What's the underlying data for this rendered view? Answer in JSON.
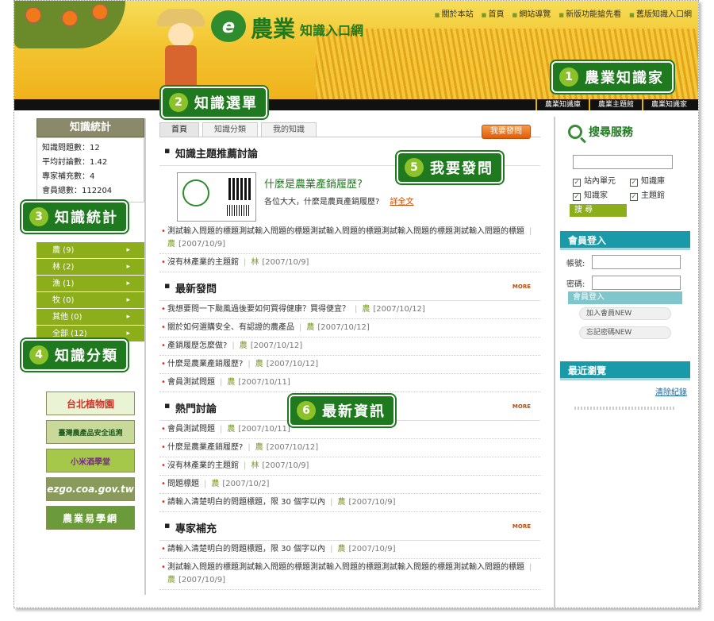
{
  "topnav": [
    "關於本站",
    "首頁",
    "網站導覽",
    "新版功能搶先看",
    "舊版知識入口網"
  ],
  "logo": {
    "mark": "e",
    "big": "農業",
    "small": "知識入口網"
  },
  "subnav": [
    "農業知識庫",
    "農業主題館",
    "農業知識家"
  ],
  "stats": {
    "title": "知識統計",
    "lines": [
      "知識問題數：12",
      "平均討論數：1.42",
      "專家補充數：4",
      "會員總數：112204"
    ]
  },
  "categories": [
    "農 (9)",
    "林 (2)",
    "漁 (1)",
    "牧 (0)",
    "其他 (0)",
    "全部 (12)"
  ],
  "ads": [
    "台北植物園",
    "臺灣農產品安全追溯",
    "小米酒學堂",
    "ezgo.coa.gov.tw",
    "農業易學網"
  ],
  "tabs": [
    "首頁",
    "知識分類",
    "我的知識"
  ],
  "ask_button": "我要發問",
  "featured": {
    "section": "知識主題推薦討論",
    "title": "什麼是農業產銷履歷?",
    "desc": "各位大大，什麼是農頁產銷履歷?",
    "link": "詳全文"
  },
  "featured_rows": [
    {
      "text": "測試輸入問題的標題測試輸入問題的標題測試輸入問題的標題測試輸入問題的標題測試輸入問題的標題",
      "cat": "農",
      "date": "[2007/10/9]"
    },
    {
      "text": "沒有林產業的主題館",
      "cat": "林",
      "date": "[2007/10/9]"
    }
  ],
  "latest": {
    "section": "最新發問",
    "more": "MORE",
    "rows": [
      {
        "text": "我想要問一下颱風過後要如何買得健康？買得便宜？",
        "cat": "農",
        "date": "[2007/10/12]"
      },
      {
        "text": "關於如何選購安全、有認證的農產品",
        "cat": "農",
        "date": "[2007/10/12]"
      },
      {
        "text": "產銷履歷怎麼做?",
        "cat": "農",
        "date": "[2007/10/12]"
      },
      {
        "text": "什麼是農業產銷履歷?",
        "cat": "農",
        "date": "[2007/10/12]"
      },
      {
        "text": "會員測試問題",
        "cat": "農",
        "date": "[2007/10/11]"
      }
    ]
  },
  "hot": {
    "section": "熱門討論",
    "more": "MORE",
    "rows": [
      {
        "text": "會員測試問題",
        "cat": "農",
        "date": "[2007/10/11]"
      },
      {
        "text": "什麼是農業產銷履歷?",
        "cat": "農",
        "date": "[2007/10/12]"
      },
      {
        "text": "沒有林產業的主題館",
        "cat": "林",
        "date": "[2007/10/9]"
      },
      {
        "text": "問題標題",
        "cat": "農",
        "date": "[2007/10/2]"
      },
      {
        "text": "請輸入清楚明白的問題標題，限 30 個字以內",
        "cat": "農",
        "date": "[2007/10/9]"
      }
    ]
  },
  "expert": {
    "section": "專家補充",
    "more": "MORE",
    "rows": [
      {
        "text": "請輸入清楚明白的問題標題，限 30 個字以內",
        "cat": "農",
        "date": "[2007/10/9]"
      },
      {
        "text": "測試輸入問題的標題測試輸入問題的標題測試輸入問題的標題測試輸入問題的標題測試輸入問題的標題",
        "cat": "農",
        "date": "[2007/10/9]"
      }
    ]
  },
  "search": {
    "title": "搜尋服務",
    "options": [
      "站內單元",
      "知識庫",
      "知識家",
      "主題館"
    ],
    "button": "搜 尋"
  },
  "login": {
    "title": "會員登入",
    "account": "帳號:",
    "password": "密碼:",
    "login_btn": "會員登入",
    "join_btn": "加入會員NEW",
    "forgot_btn": "忘記密碼NEW"
  },
  "recent": {
    "title": "最近瀏覽",
    "clear": "清除紀錄"
  },
  "callouts": [
    {
      "num": "1",
      "text": "農業知識家"
    },
    {
      "num": "2",
      "text": "知識選單"
    },
    {
      "num": "3",
      "text": "知識統計"
    },
    {
      "num": "4",
      "text": "知識分類"
    },
    {
      "num": "5",
      "text": "我要發問"
    },
    {
      "num": "6",
      "text": "最新資訊"
    }
  ]
}
